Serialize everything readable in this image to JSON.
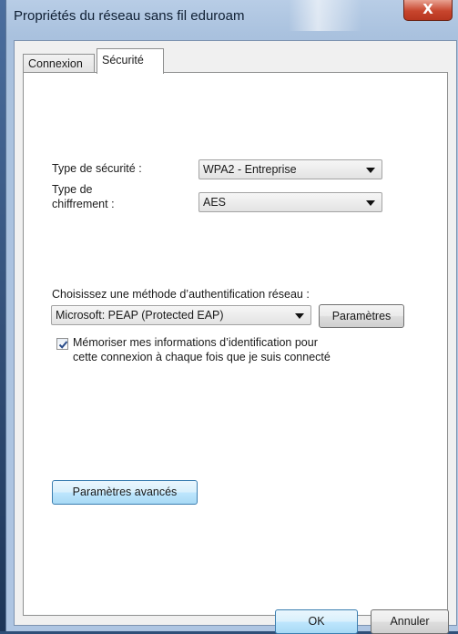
{
  "window": {
    "title": "Propriétés du réseau sans fil eduroam",
    "close_glyph": "X"
  },
  "tabs": [
    {
      "label": "Connexion",
      "active": false
    },
    {
      "label": "Sécurité",
      "active": true
    }
  ],
  "security": {
    "type_label": "Type de sécurité :",
    "type_value": "WPA2 - Entreprise",
    "encryption_label_line1": "Type de",
    "encryption_label_line2": "chiffrement :",
    "encryption_value": "AES"
  },
  "auth": {
    "method_label": "Choisissez une méthode d’authentification réseau :",
    "method_value": "Microsoft: PEAP (Protected EAP)",
    "settings_button": "Paramètres",
    "remember_checked": true,
    "remember_line1": "Mémoriser mes informations d’identification pour",
    "remember_line2": "cette connexion à chaque fois que je suis connecté"
  },
  "advanced_button": "Paramètres avancés",
  "footer": {
    "ok": "OK",
    "cancel": "Annuler"
  }
}
